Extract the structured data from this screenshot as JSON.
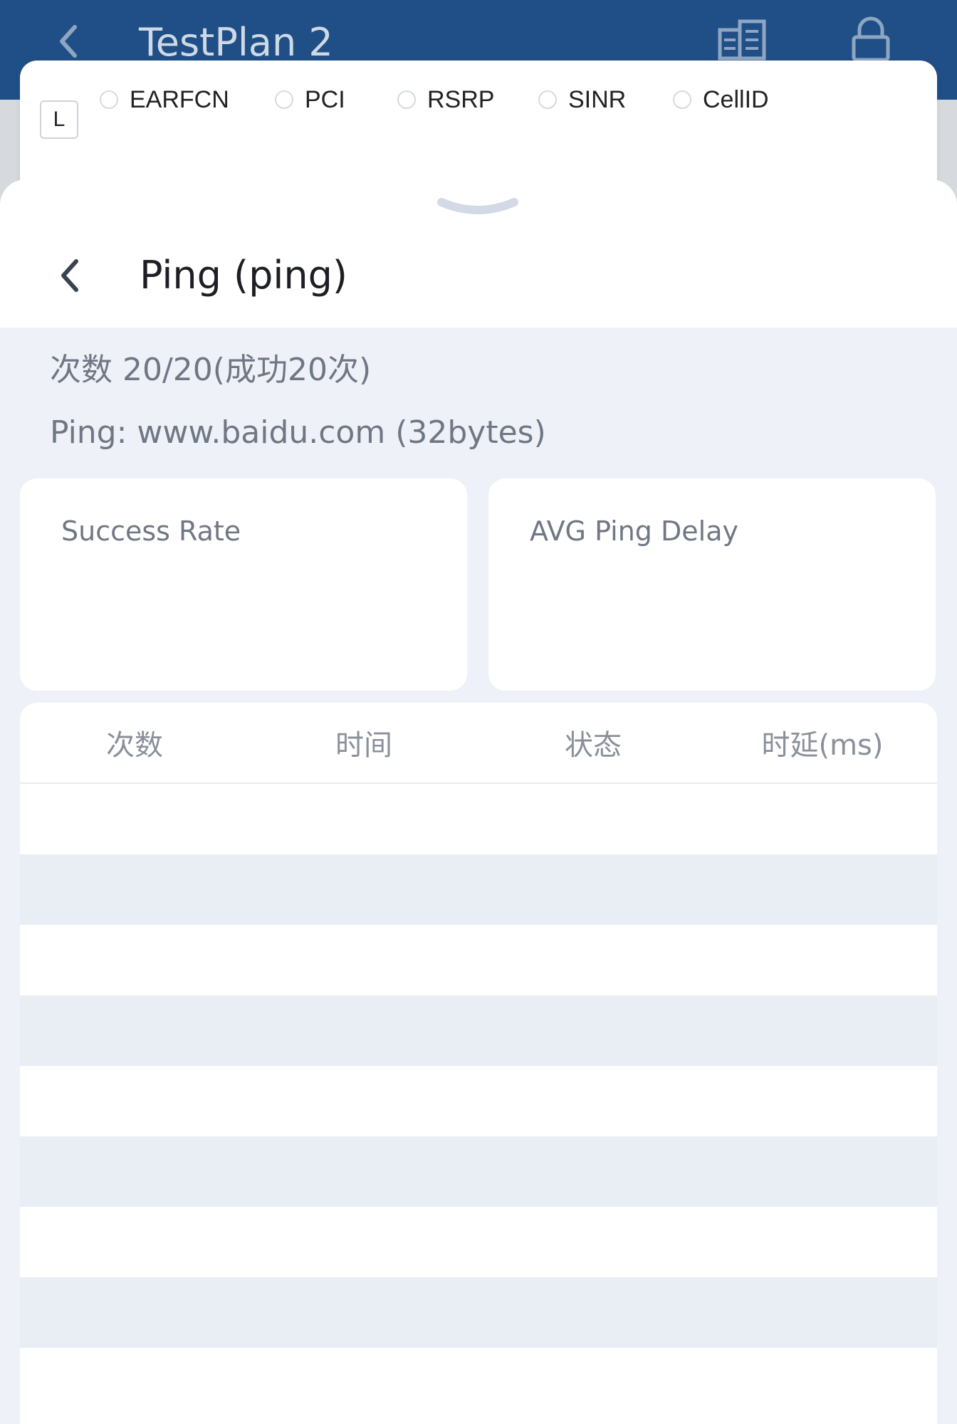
{
  "appbar": {
    "title": "TestPlan 2",
    "icons": [
      "back-chevron-icon",
      "building-icon",
      "lock-icon"
    ]
  },
  "layers": {
    "toggle_label": "L",
    "options": [
      {
        "label": "EARFCN",
        "selected": false
      },
      {
        "label": "PCI",
        "selected": false
      },
      {
        "label": "RSRP",
        "selected": false
      },
      {
        "label": "SINR",
        "selected": false
      },
      {
        "label": "CellID",
        "selected": false
      }
    ]
  },
  "sheet": {
    "title": "Ping (ping)",
    "count_line": "次数 20/20(成功20次)",
    "target_line": "Ping: www.baidu.com (32bytes)",
    "stats": {
      "success_rate_label": "Success Rate",
      "avg_delay_label": "AVG Ping Delay"
    },
    "table": {
      "headers": [
        "次数",
        "时间",
        "状态",
        "时延(ms)"
      ],
      "rows": [
        [
          "",
          "",
          "",
          ""
        ],
        [
          "",
          "",
          "",
          ""
        ],
        [
          "",
          "",
          "",
          ""
        ],
        [
          "",
          "",
          "",
          ""
        ],
        [
          "",
          "",
          "",
          ""
        ],
        [
          "",
          "",
          "",
          ""
        ],
        [
          "",
          "",
          "",
          ""
        ],
        [
          "",
          "",
          "",
          ""
        ],
        [
          "",
          "",
          "",
          ""
        ]
      ]
    }
  },
  "colors": {
    "appbar_bg": "#1f4f86",
    "page_bg": "#eef2f8",
    "row_alt": "#e9edf4",
    "muted_text": "#707784"
  }
}
